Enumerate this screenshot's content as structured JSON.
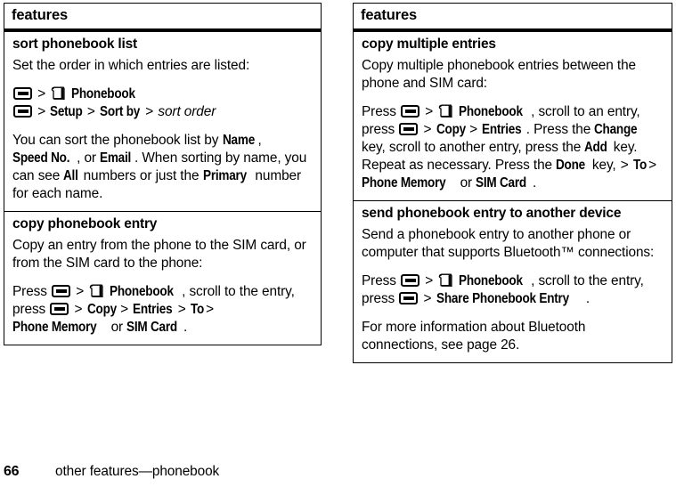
{
  "page": {
    "number": "66",
    "footer_text": "other features—phonebook"
  },
  "icons": {
    "menu_key": "menu-key-icon",
    "phonebook": "phonebook-book-icon"
  },
  "left_table": {
    "header": "features",
    "sections": [
      {
        "title": "sort phonebook list",
        "paragraphs": [
          {
            "id": "p1",
            "text": "Set the order in which entries are listed:"
          },
          {
            "id": "p2",
            "runs": [
              {
                "type": "icon",
                "value": "menu-key"
              },
              {
                "type": "gt",
                "value": ">"
              },
              {
                "type": "icon",
                "value": "phonebook"
              },
              {
                "type": "ui",
                "value": "Phonebook"
              },
              {
                "type": "break"
              },
              {
                "type": "icon",
                "value": "menu-key"
              },
              {
                "type": "gt",
                "value": ">"
              },
              {
                "type": "ui",
                "value": "Setup"
              },
              {
                "type": "gt",
                "value": ">"
              },
              {
                "type": "ui",
                "value": "Sort by"
              },
              {
                "type": "gt",
                "value": ">"
              },
              {
                "type": "var",
                "value": "sort order"
              }
            ]
          },
          {
            "id": "p3",
            "runs": [
              {
                "type": "text",
                "value": "You can sort the phonebook list by "
              },
              {
                "type": "ui",
                "value": "Name"
              },
              {
                "type": "text",
                "value": ", "
              },
              {
                "type": "ui",
                "value": "Speed No."
              },
              {
                "type": "text",
                "value": ", or "
              },
              {
                "type": "ui",
                "value": "Email"
              },
              {
                "type": "text",
                "value": ". When sorting by name, you can see "
              },
              {
                "type": "ui",
                "value": "All"
              },
              {
                "type": "text",
                "value": " numbers or just the "
              },
              {
                "type": "ui",
                "value": "Primary"
              },
              {
                "type": "text",
                "value": " number for each name."
              }
            ]
          }
        ]
      },
      {
        "title": "copy phonebook entry",
        "paragraphs": [
          {
            "id": "p1",
            "text": "Copy an entry from the phone to the SIM card, or from the SIM card to the phone:"
          },
          {
            "id": "p2",
            "runs": [
              {
                "type": "text",
                "value": "Press "
              },
              {
                "type": "icon",
                "value": "menu-key"
              },
              {
                "type": "gt",
                "value": ">"
              },
              {
                "type": "icon",
                "value": "phonebook"
              },
              {
                "type": "ui",
                "value": "Phonebook"
              },
              {
                "type": "text",
                "value": ", scroll to the entry, press "
              },
              {
                "type": "icon",
                "value": "menu-key"
              },
              {
                "type": "gt",
                "value": ">"
              },
              {
                "type": "ui",
                "value": "Copy"
              },
              {
                "type": "gt",
                "value": ">"
              },
              {
                "type": "ui",
                "value": "Entries"
              },
              {
                "type": "gt",
                "value": ">"
              },
              {
                "type": "ui",
                "value": "To"
              },
              {
                "type": "gt",
                "value": ">"
              },
              {
                "type": "ui",
                "value": "Phone Memory"
              },
              {
                "type": "text",
                "value": " or "
              },
              {
                "type": "ui",
                "value": "SIM Card"
              },
              {
                "type": "text",
                "value": "."
              }
            ]
          }
        ]
      }
    ]
  },
  "right_table": {
    "header": "features",
    "sections": [
      {
        "title": "copy multiple entries",
        "paragraphs": [
          {
            "id": "p1",
            "text": "Copy multiple phonebook entries between the phone and SIM card:"
          },
          {
            "id": "p2",
            "runs": [
              {
                "type": "text",
                "value": "Press "
              },
              {
                "type": "icon",
                "value": "menu-key"
              },
              {
                "type": "gt",
                "value": ">"
              },
              {
                "type": "icon",
                "value": "phonebook"
              },
              {
                "type": "ui",
                "value": "Phonebook"
              },
              {
                "type": "text",
                "value": ", scroll to an entry, press "
              },
              {
                "type": "icon",
                "value": "menu-key"
              },
              {
                "type": "gt",
                "value": ">"
              },
              {
                "type": "ui",
                "value": "Copy"
              },
              {
                "type": "gt",
                "value": ">"
              },
              {
                "type": "ui",
                "value": "Entries"
              },
              {
                "type": "text",
                "value": ". Press the "
              },
              {
                "type": "ui",
                "value": "Change"
              },
              {
                "type": "text",
                "value": " key, scroll to another entry, press the "
              },
              {
                "type": "ui",
                "value": "Add"
              },
              {
                "type": "text",
                "value": " key. Repeat as necessary. Press the "
              },
              {
                "type": "ui",
                "value": "Done"
              },
              {
                "type": "text",
                "value": " key, "
              },
              {
                "type": "gt",
                "value": ">"
              },
              {
                "type": "ui",
                "value": "To"
              },
              {
                "type": "gt",
                "value": ">"
              },
              {
                "type": "ui",
                "value": "Phone Memory"
              },
              {
                "type": "text",
                "value": " or "
              },
              {
                "type": "ui",
                "value": "SIM Card"
              },
              {
                "type": "text",
                "value": "."
              }
            ]
          }
        ]
      },
      {
        "title": "send phonebook entry to another device",
        "paragraphs": [
          {
            "id": "p1",
            "text": "Send a phonebook entry to another phone or computer that supports Bluetooth™ connections:"
          },
          {
            "id": "p2",
            "runs": [
              {
                "type": "text",
                "value": "Press "
              },
              {
                "type": "icon",
                "value": "menu-key"
              },
              {
                "type": "gt",
                "value": ">"
              },
              {
                "type": "icon",
                "value": "phonebook"
              },
              {
                "type": "ui",
                "value": "Phonebook"
              },
              {
                "type": "text",
                "value": ", scroll to the entry, press "
              },
              {
                "type": "icon",
                "value": "menu-key"
              },
              {
                "type": "gt",
                "value": ">"
              },
              {
                "type": "ui",
                "value": "Share Phonebook Entry"
              },
              {
                "type": "text",
                "value": "."
              }
            ]
          },
          {
            "id": "p3",
            "text": "For more information about Bluetooth connections, see page 26."
          }
        ]
      }
    ]
  }
}
